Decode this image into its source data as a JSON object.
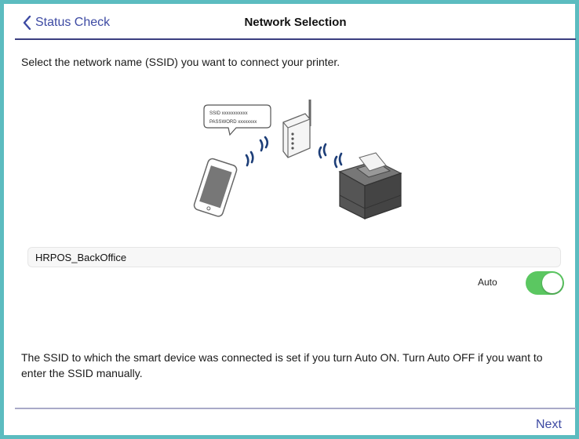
{
  "header": {
    "back_label": "Status Check",
    "title": "Network Selection"
  },
  "instruction": "Select the network name (SSID) you want to connect your printer.",
  "illustration": {
    "bubble_ssid": "SSID  xxxxxxxxxxx",
    "bubble_password": "PASSWORD  xxxxxxxx"
  },
  "ssid_field": {
    "value": "HRPOS_BackOffice"
  },
  "auto": {
    "label": "Auto",
    "state": true,
    "color": "#5bc761"
  },
  "note": "The SSID to which the smart device was connected is set if you turn Auto ON. Turn Auto OFF if you want to enter the SSID manually.",
  "footer": {
    "next_label": "Next"
  },
  "colors": {
    "frame": "#5cbcc0",
    "accent": "#3d4aa3",
    "header_rule": "#3b3f80"
  },
  "icons": [
    "chevron-left-icon",
    "wifi-router-icon",
    "smartphone-icon",
    "receipt-printer-icon",
    "wifi-signal-icon"
  ]
}
